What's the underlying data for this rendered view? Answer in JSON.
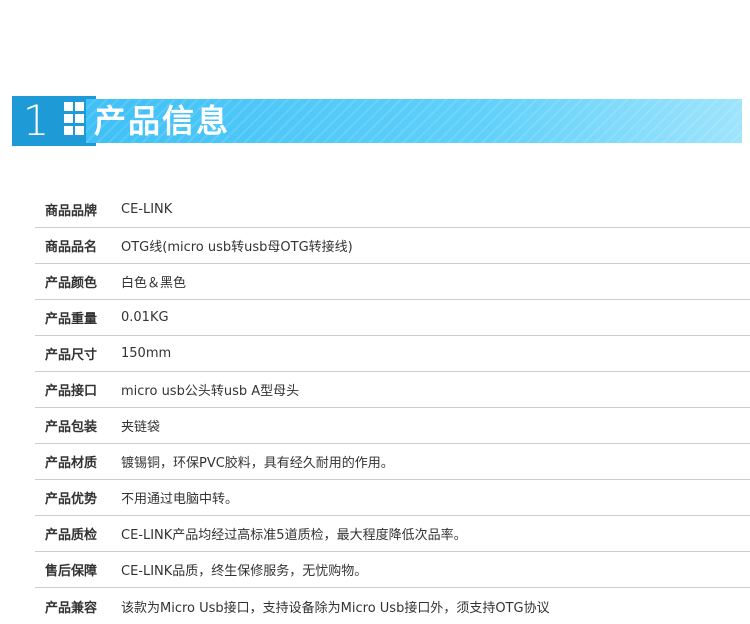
{
  "banner": {
    "number": "1",
    "title": "产品信息"
  },
  "colors": {
    "banner_dark": "#1e9bd7",
    "banner_light": "#3fc0f6",
    "divider": "#cccccc",
    "text": "#333333"
  },
  "rows": [
    {
      "label": "商品品牌",
      "value": "CE-LINK"
    },
    {
      "label": "商品品名",
      "value": "OTG线(micro usb转usb母OTG转接线)"
    },
    {
      "label": "产品颜色",
      "value": "白色＆黑色"
    },
    {
      "label": "产品重量",
      "value": "0.01KG"
    },
    {
      "label": "产品尺寸",
      "value": "150mm"
    },
    {
      "label": "产品接口",
      "value": "micro usb公头转usb A型母头"
    },
    {
      "label": "产品包装",
      "value": "夹链袋"
    },
    {
      "label": "产品材质",
      "value": "镀锡铜，环保PVC胶料，具有经久耐用的作用。"
    },
    {
      "label": "产品优势",
      "value": "不用通过电脑中转。"
    },
    {
      "label": "产品质检",
      "value": "CE-LINK产品均经过高标准5道质检，最大程度降低次品率。"
    },
    {
      "label": "售后保障",
      "value": "CE-LINK品质，终生保修服务，无忧购物。"
    },
    {
      "label": "产品兼容",
      "value": "该款为Micro Usb接口，支持设备除为Micro Usb接口外，须支持OTG协议"
    }
  ]
}
